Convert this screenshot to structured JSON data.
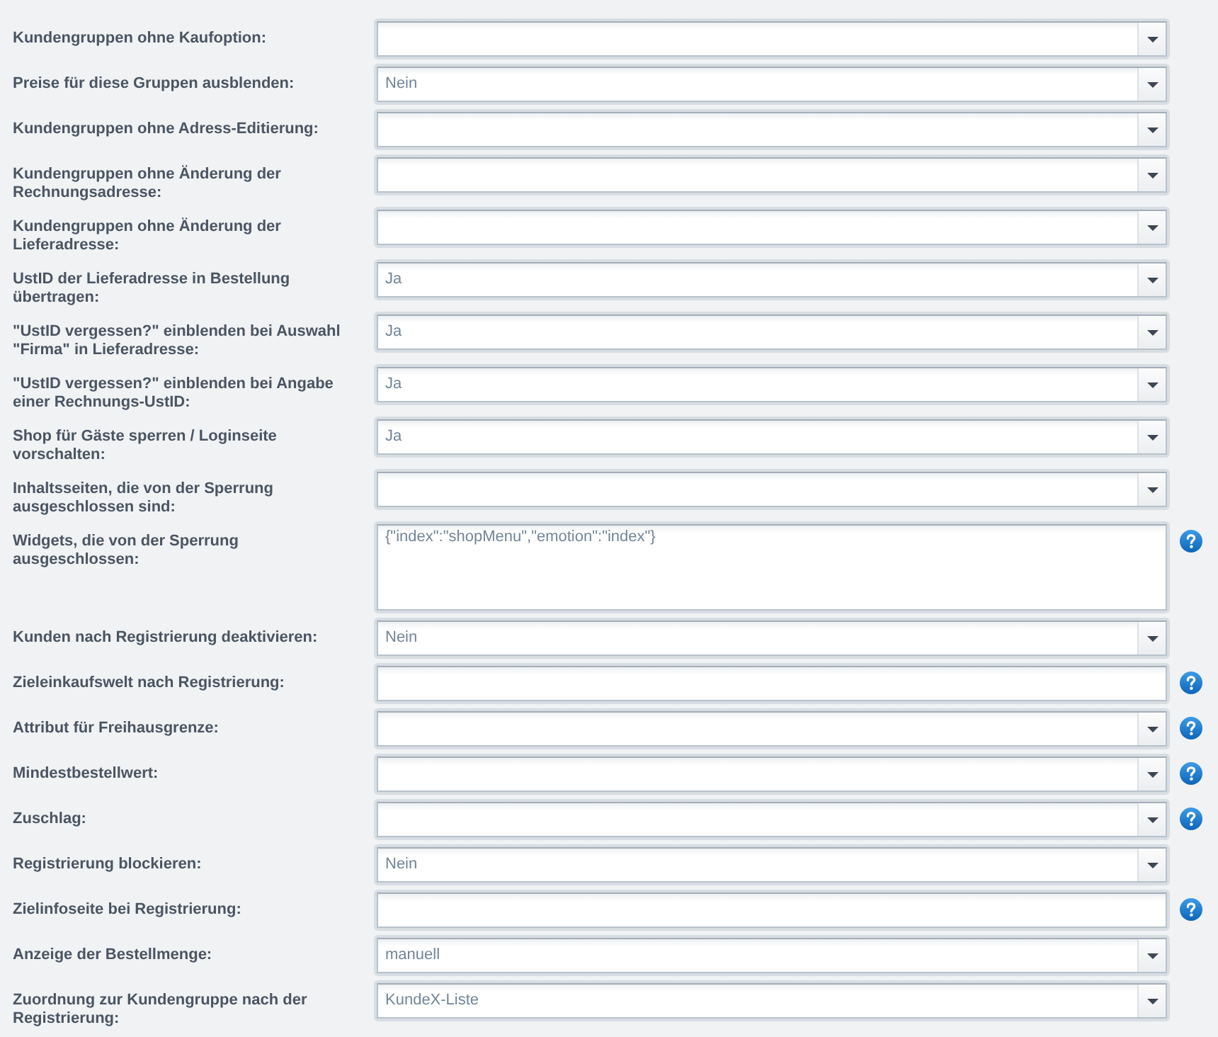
{
  "form": {
    "fields": [
      {
        "label": "Kundengruppen ohne Kaufoption:",
        "kind": "combo",
        "help": false
      },
      {
        "label": "Preise für diese Gruppen ausblenden:",
        "kind": "combo",
        "value": "Nein",
        "help": false
      },
      {
        "label": "Kundengruppen ohne Adress-Editierung:",
        "kind": "combo",
        "help": false
      },
      {
        "label": "Kundengruppen ohne Änderung der Rechnungsadresse:",
        "kind": "combo",
        "help": false
      },
      {
        "label": "Kundengruppen ohne Änderung der Lieferadresse:",
        "kind": "combo",
        "help": false
      },
      {
        "label": "UstID der Lieferadresse in Bestellung übertragen:",
        "kind": "combo",
        "value": "Ja",
        "help": false
      },
      {
        "label": "\"UstID vergessen?\" einblenden bei Auswahl \"Firma\" in Lieferadresse:",
        "kind": "combo",
        "value": "Ja",
        "help": false
      },
      {
        "label": "\"UstID vergessen?\" einblenden bei Angabe einer Rechnungs-UstID:",
        "kind": "combo",
        "value": "Ja",
        "help": false
      },
      {
        "label": "Shop für Gäste sperren / Loginseite vorschalten:",
        "kind": "combo",
        "value": "Ja",
        "help": false
      },
      {
        "label": "Inhaltsseiten, die von der Sperrung ausgeschlossen sind:",
        "kind": "combo",
        "help": false
      },
      {
        "label": "Widgets, die von der Sperrung ausgeschlossen:",
        "kind": "textarea",
        "value": "{\"index\":\"shopMenu\",\"emotion\":\"index\"}",
        "help": true
      },
      {
        "label": "Kunden nach Registrierung deaktivieren:",
        "kind": "combo",
        "value": "Nein",
        "help": false
      },
      {
        "label": "Zieleinkaufswelt nach Registrierung:",
        "kind": "text",
        "help": true
      },
      {
        "label": "Attribut für Freihausgrenze:",
        "kind": "combo",
        "help": true
      },
      {
        "label": "Mindestbestellwert:",
        "kind": "combo",
        "help": true
      },
      {
        "label": "Zuschlag:",
        "kind": "combo",
        "help": true
      },
      {
        "label": "Registrierung blockieren:",
        "kind": "combo",
        "value": "Nein",
        "help": false
      },
      {
        "label": "Zielinfoseite bei Registrierung:",
        "kind": "text",
        "help": true
      },
      {
        "label": "Anzeige der Bestellmenge:",
        "kind": "combo",
        "value": "manuell",
        "help": false
      },
      {
        "label": "Zuordnung zur Kundengruppe nach der Registrierung:",
        "kind": "combo",
        "value": "KundeX-Liste",
        "help": false
      }
    ]
  }
}
